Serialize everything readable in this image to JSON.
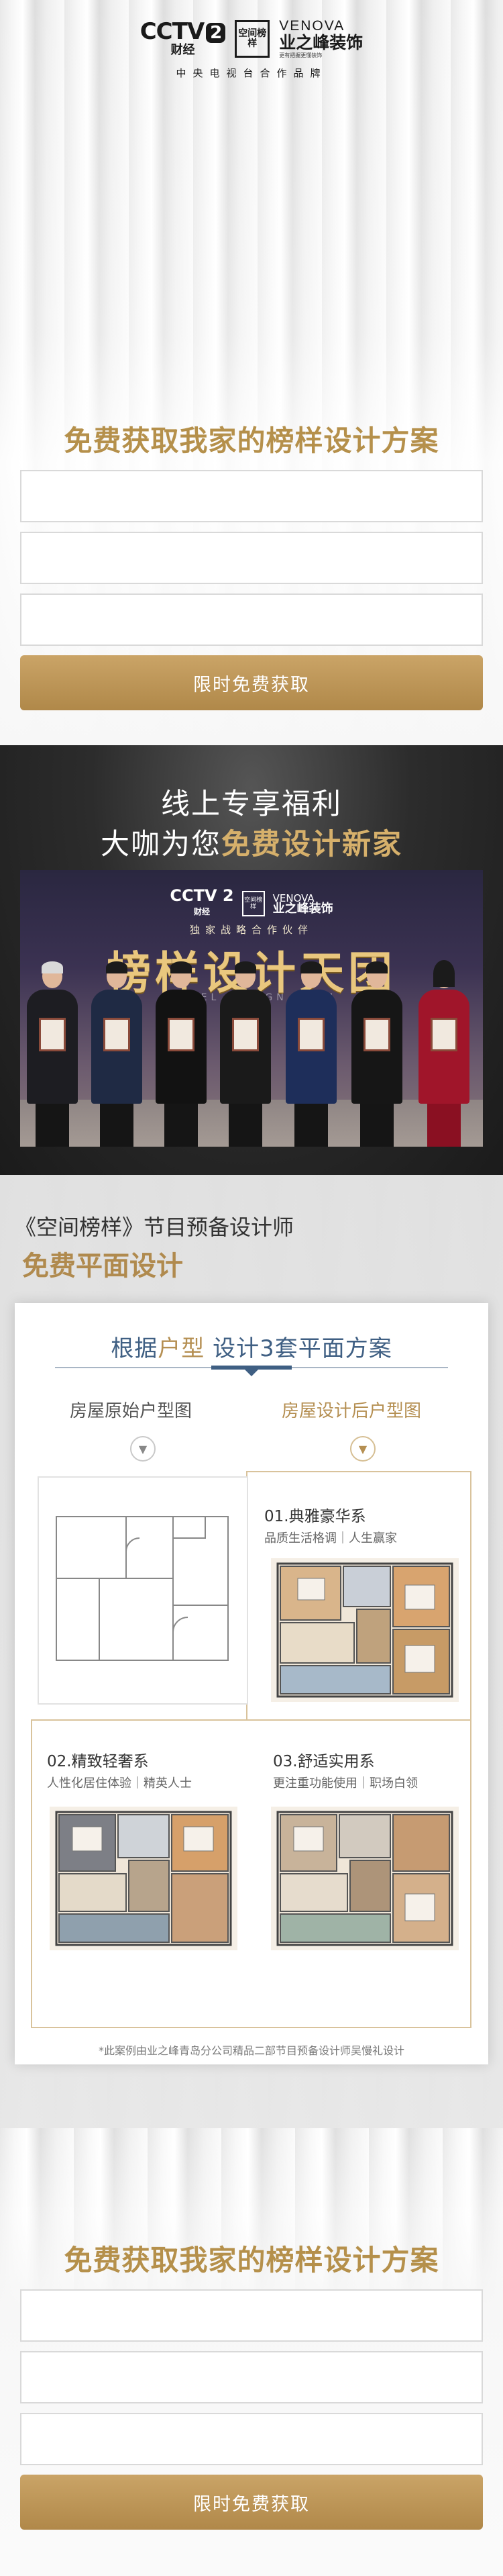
{
  "header": {
    "cctv_text": "CCTV",
    "cctv_channel": "2",
    "cctv_sub": "财经",
    "program_stamp": "空间榜样",
    "brand_en": "VENOVA",
    "brand_cn": "业之峰装饰",
    "brand_tagline": "更有把握更懂装饰",
    "caption": "中央电视台合作品牌"
  },
  "form_top": {
    "title": "免费获取我家的榜样设计方案",
    "fields": [
      {
        "value": "",
        "placeholder": ""
      },
      {
        "value": "",
        "placeholder": ""
      },
      {
        "value": "",
        "placeholder": ""
      }
    ],
    "submit_label": "限时免费获取"
  },
  "promo": {
    "line1": "线上专享福利",
    "line2_prefix": "大咖为您",
    "line2_highlight": "免费设计新家",
    "photo": {
      "cctv_text": "CCTV 2",
      "cctv_sub": "财经",
      "stamp": "空间榜样",
      "brand_en": "VENOVA",
      "brand_cn": "业之峰装饰",
      "partner_text": "独家战略合作伙伴",
      "team_title": "榜样设计天团",
      "team_subtitle": "MODEL DESIGN TEAM"
    }
  },
  "plans": {
    "eyebrow": "《空间榜样》节目预备设计师",
    "headline": "免费平面设计",
    "card_title_prefix": "根据",
    "card_title_highlight": "户型",
    "card_title_suffix": " 设计3套平面方案",
    "left_label": "房屋原始户型图",
    "right_label": "房屋设计后户型图",
    "options": [
      {
        "title": "01.典雅豪华系",
        "subtitle": "品质生活格调｜人生赢家"
      },
      {
        "title": "02.精致轻奢系",
        "subtitle": "人性化居住体验｜精英人士"
      },
      {
        "title": "03.舒适实用系",
        "subtitle": "更注重功能使用｜职场白领"
      }
    ],
    "footnote": "*此案例由业之峰青岛分公司精品二部节目预备设计师吴慢礼设计"
  },
  "form_bottom": {
    "title": "免费获取我家的榜样设计方案",
    "fields": [
      {
        "value": "",
        "placeholder": ""
      },
      {
        "value": "",
        "placeholder": ""
      },
      {
        "value": "",
        "placeholder": ""
      }
    ],
    "submit_label": "限时免费获取"
  },
  "colors": {
    "gold": "#b5904b",
    "navy": "#3f5f83",
    "dark_bg": "#2c2c2c"
  }
}
